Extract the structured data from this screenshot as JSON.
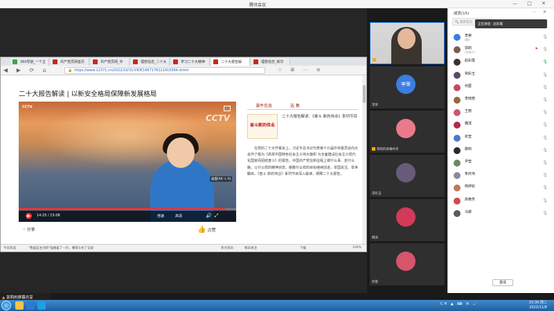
{
  "meeting": {
    "title": "腾讯会议",
    "window_controls": "— □ ✕"
  },
  "browser": {
    "tabs": [
      {
        "label": "360导航_一个主",
        "color": "#3aa84a"
      },
      {
        "label": "共产党员网首页",
        "color": "#c8281e"
      },
      {
        "label": "共产党员网_中",
        "color": "#c8281e"
      },
      {
        "label": "理想信念_二十大",
        "color": "#c8281e"
      },
      {
        "label": "学习二十大精神",
        "color": "#c8281e"
      },
      {
        "label": "二十大报告解",
        "color": "#c8281e"
      },
      {
        "label": "理想信念_新华",
        "color": "#c8281e"
      }
    ],
    "url": "https://www.12371.cn/2022/10/31/VIDE1667178121415584.shtml",
    "nav_icons": "◀ ▶ ⟳ ⌂",
    "tool_icons": "☆ ⊞ ⋯ ≡"
  },
  "page": {
    "title": "二十大报告解读 | 以新安全格局保障新发展格局",
    "video": {
      "time": "14:25 / 15:08",
      "progress": 0.95,
      "logo": "CCTV",
      "pip_label": "画面(Alt + A)",
      "quality_buttons": [
        "倍速",
        "高清"
      ]
    },
    "share_label": "分享",
    "like_label": "点赞",
    "side_tabs": [
      "课件信息",
      "选 集"
    ],
    "promo_image_text": "奋斗新的伟业",
    "promo_text": "二十大报告解读：《奋斗 新的伟业》系列节目",
    "description": "在党的二十大开幕会上，习近平总书记代表第十九届中央委员会向大会作了题为《高举中国特色社会主义伟大旗帜 为全面建设社会主义现代化国家而团结奋斗》的报告。中国共产党在新征程上做什么事、走什么路，以什么样的精神状态、朝着什么样的目标继续前进，举国关注、举世瞩目。《奋斗 新的伟业》系列节目深入解读、阐释二十大报告。"
  },
  "browser_status": {
    "left": "今日优选",
    "news": "\"我国自主创新\"强顺喜了一声，赚得头条了记录",
    "items": [
      "热点资讯",
      "每日关注",
      "下载",
      "100%"
    ]
  },
  "video_grid": [
    {
      "name": "赵彩霞",
      "type": "camera"
    },
    {
      "name": "李荣",
      "type": "avatar",
      "avatar_text": "李荣"
    },
    {
      "name": "郭莉的屏幕共享",
      "type": "avatar",
      "avatar_color": "#e97a8a"
    },
    {
      "name": "常彩玉",
      "type": "avatar",
      "avatar_color": "#6a5a7a"
    },
    {
      "name": "魏滨",
      "type": "avatar",
      "avatar_color": "#d23a5a"
    },
    {
      "name": "何蓉",
      "type": "avatar",
      "avatar_color": "#d6556b"
    }
  ],
  "members": {
    "title": "成员(15)",
    "controls": "⋯ ✕",
    "search_placeholder": "搜索成员",
    "speaking": "正在讲话：赵彩霞",
    "list": [
      {
        "name": "李荣",
        "sub": "(我)",
        "color": "#3b7de0",
        "mic_on": false
      },
      {
        "name": "郭莉",
        "sub": "(主持人)",
        "color": "#7a5d4a",
        "mic_on": false,
        "extra": "⚑"
      },
      {
        "name": "赵彩霞",
        "sub": "",
        "color": "#3a3430",
        "mic_on": true
      },
      {
        "name": "常彩玉",
        "sub": "",
        "color": "#5a4a66",
        "mic_on": false
      },
      {
        "name": "何蓉",
        "sub": "",
        "color": "#c44a5a",
        "mic_on": false
      },
      {
        "name": "李晓丽",
        "sub": "",
        "color": "#9a6a3a",
        "mic_on": false
      },
      {
        "name": "王丽",
        "sub": "",
        "color": "#c85a6a",
        "mic_on": false
      },
      {
        "name": "魏滨",
        "sub": "",
        "color": "#b32a4a",
        "mic_on": false
      },
      {
        "name": "张莹",
        "sub": "",
        "color": "#4a7ac0",
        "mic_on": false
      },
      {
        "name": "康莉",
        "sub": "",
        "color": "#2a2a2a",
        "mic_on": false
      },
      {
        "name": "尹莹",
        "sub": "",
        "color": "#6a8a5a",
        "mic_on": false
      },
      {
        "name": "朱庆伟",
        "sub": "",
        "color": "#8a8a9a",
        "mic_on": false
      },
      {
        "name": "杨婷钦",
        "sub": "",
        "color": "#c07a5a",
        "mic_on": false
      },
      {
        "name": "高艳芳",
        "sub": "",
        "color": "#d04a4a",
        "mic_on": false
      },
      {
        "name": "马媛",
        "sub": "",
        "color": "#5a5a5a",
        "mic_on": false
      }
    ],
    "invite_label": "邀请"
  },
  "share_indicator": "郭莉的屏幕共享",
  "taskbar": {
    "tray": "CH ▲ ⌨ ✉ 🔊",
    "time": "15:30 周二",
    "date": "2022/11/8"
  }
}
